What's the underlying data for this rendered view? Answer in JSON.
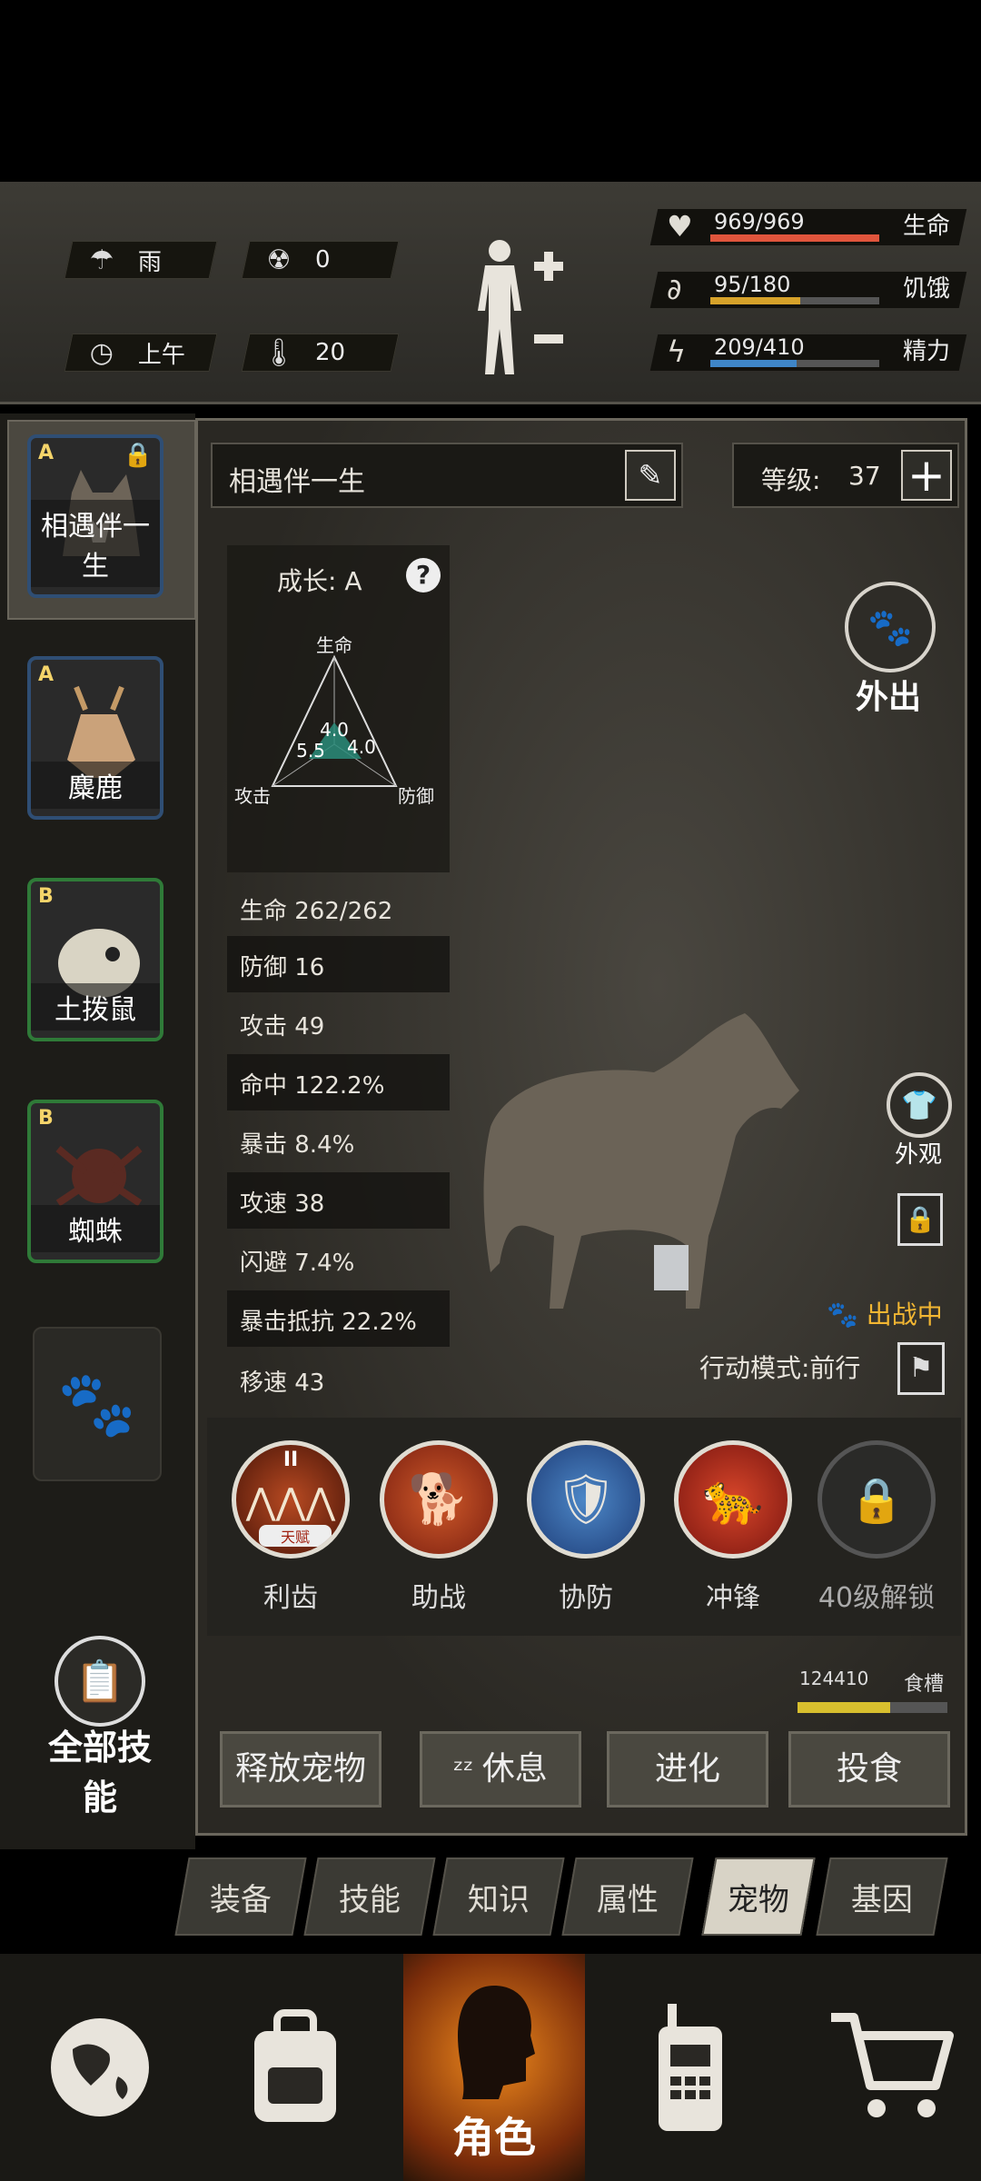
{
  "environment": {
    "weather": {
      "icon": "rain-icon",
      "label": "雨"
    },
    "radiation": {
      "icon": "radiation-icon",
      "value": "0"
    },
    "time": {
      "icon": "clock-icon",
      "label": "上午"
    },
    "temperature": {
      "icon": "thermometer-icon",
      "value": "20"
    }
  },
  "player_stats": [
    {
      "icon": "heart-icon",
      "value": "969/969",
      "label": "生命",
      "fraction": 1.0,
      "color": "#e0553c"
    },
    {
      "icon": "stomach-icon",
      "value": "95/180",
      "label": "饥饿",
      "fraction": 0.53,
      "color": "#d6a22a"
    },
    {
      "icon": "energy-icon",
      "value": "209/410",
      "label": "精力",
      "fraction": 0.51,
      "color": "#3f86c8"
    }
  ],
  "pets": [
    {
      "name": "相遇伴一生",
      "grade": "A",
      "locked": true,
      "selected": true
    },
    {
      "name": "麋鹿",
      "grade": "A",
      "locked": false
    },
    {
      "name": "土拨鼠",
      "grade": "B",
      "locked": false
    },
    {
      "name": "蜘蛛",
      "grade": "B",
      "locked": false
    }
  ],
  "pet_detail": {
    "name": "相遇伴一生",
    "level_label": "等级:",
    "level": "37",
    "growth_label": "成长: A",
    "radar": {
      "top_label": "生命",
      "left_label": "攻击",
      "right_label": "防御",
      "values": {
        "life": "4.0",
        "attack": "5.5",
        "defense": "4.0"
      }
    },
    "attributes": [
      "生命 262/262",
      "防御 16",
      "攻击 49",
      "命中 122.2%",
      "暴击 8.4%",
      "攻速 38",
      "闪避 7.4%",
      "暴击抵抗 22.2%",
      "移速 43"
    ],
    "outing_label": "外出",
    "appearance_label": "外观",
    "status_label": "出战中",
    "mode_label": "行动模式:前行"
  },
  "skills": [
    {
      "label": "利齿",
      "badge": "天赋",
      "roman": "II"
    },
    {
      "label": "助战"
    },
    {
      "label": "协防"
    },
    {
      "label": "冲锋"
    },
    {
      "label": "40级解锁",
      "locked": true
    }
  ],
  "food": {
    "value": "124410",
    "label": "食槽",
    "fraction": 0.62
  },
  "actions": [
    "释放宠物",
    "休息",
    "进化",
    "投食"
  ],
  "all_skills_label": "全部技能",
  "tabs": [
    "装备",
    "技能",
    "知识",
    "属性",
    "宠物",
    "基因"
  ],
  "active_tab": "宠物",
  "nav": {
    "role_label": "角色"
  }
}
